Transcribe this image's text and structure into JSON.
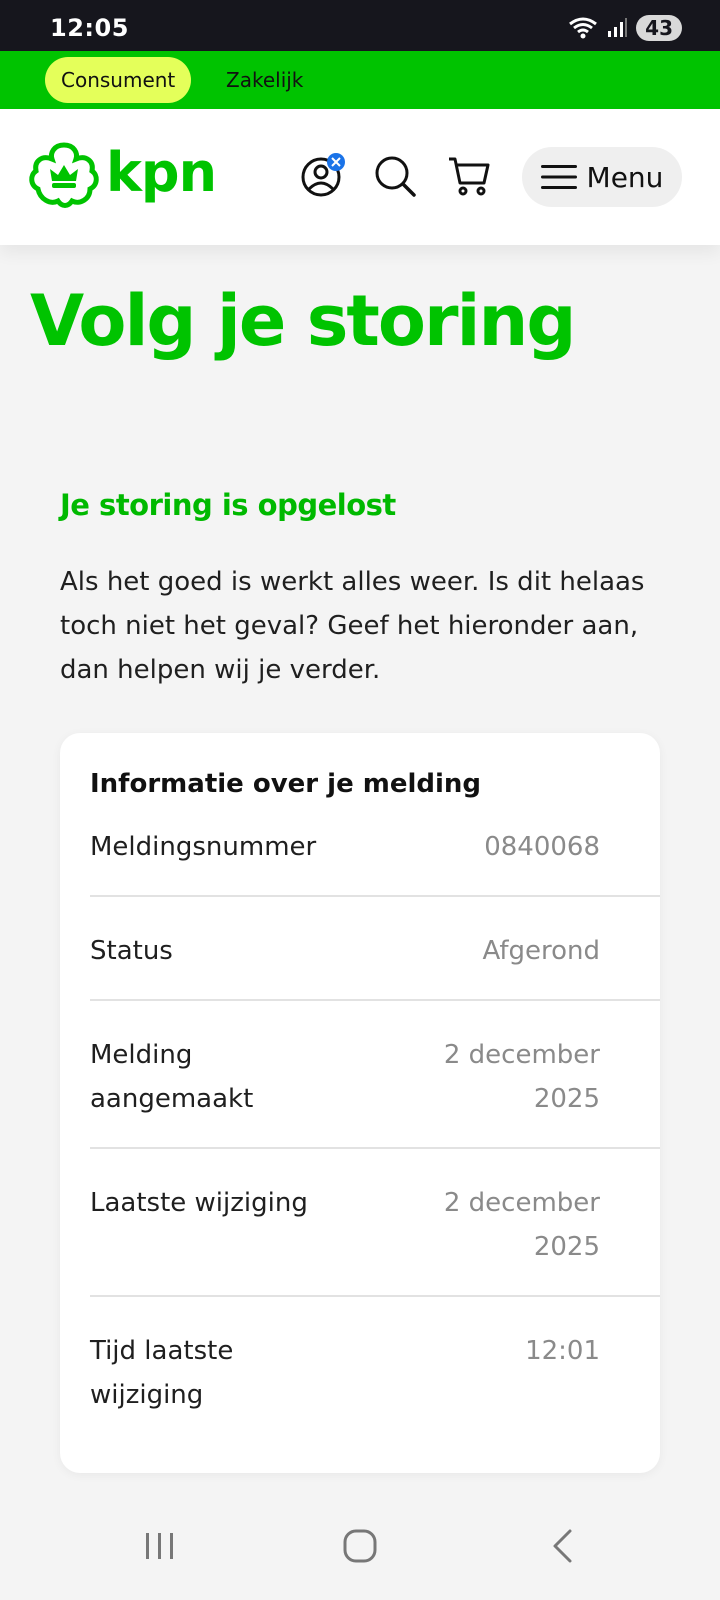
{
  "status_bar": {
    "time": "12:05",
    "battery": "43"
  },
  "segments": {
    "active": "Consument",
    "other": "Zakelijk"
  },
  "header": {
    "logo_text": "kpn",
    "menu_label": "Menu"
  },
  "page": {
    "title": "Volg je storing",
    "subtitle": "Je storing is opgelost",
    "intro": "Als het goed is werkt alles weer. Is dit helaas toch niet het geval? Geef het hieronder aan, dan helpen wij je verder."
  },
  "card": {
    "title": "Informatie over je melding",
    "rows": [
      {
        "label": "Meldingsnummer",
        "value": "0840068"
      },
      {
        "label": "Status",
        "value": "Afgerond"
      },
      {
        "label": "Melding aangemaakt",
        "value": "2 december 2025"
      },
      {
        "label": "Laatste wijziging",
        "value": "2 december 2025"
      },
      {
        "label": "Tijd laatste wijziging",
        "value": "12:01"
      }
    ]
  },
  "colors": {
    "brand_green": "#00c300",
    "segment_active": "#e4ff5a",
    "badge_blue": "#1a73e8"
  },
  "icons": [
    "wifi-icon",
    "signal-icon",
    "account-icon",
    "search-icon",
    "cart-icon",
    "hamburger-icon",
    "recents-icon",
    "home-icon",
    "back-icon"
  ]
}
